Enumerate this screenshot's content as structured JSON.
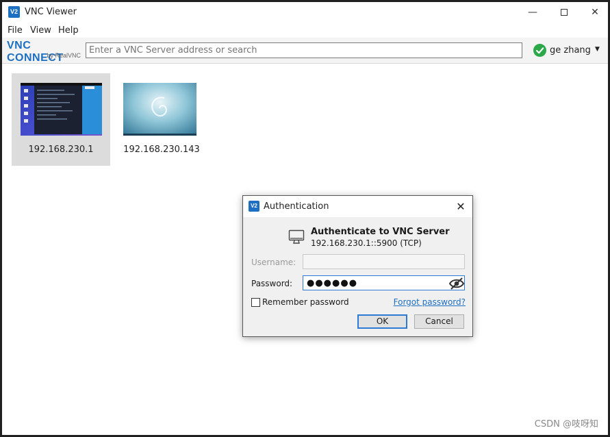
{
  "window": {
    "title": "VNC Viewer",
    "icon_text": "V2",
    "minimize_glyph": "—",
    "close_glyph": "✕"
  },
  "menu": {
    "items": [
      "File",
      "View",
      "Help"
    ]
  },
  "toolbar": {
    "logo_main": "VNC CONNECT",
    "logo_sub": "by RealVNC",
    "search_placeholder": "Enter a VNC Server address or search",
    "user_name": "ge zhang",
    "dropdown_glyph": "▼"
  },
  "connections": [
    {
      "label": "192.168.230.1",
      "selected": true
    },
    {
      "label": "192.168.230.143",
      "selected": false
    }
  ],
  "dialog": {
    "title": "Authentication",
    "icon_text": "V2",
    "close_glyph": "✕",
    "heading": "Authenticate to VNC Server",
    "server": "192.168.230.1::5900 (TCP)",
    "username_label": "Username:",
    "password_label": "Password:",
    "password_masked": "●●●●●●",
    "remember_label": "Remember password",
    "forgot_link": "Forgot password?",
    "ok_label": "OK",
    "cancel_label": "Cancel"
  },
  "watermark": "CSDN @吱呀知",
  "colors": {
    "accent": "#1d6fc2",
    "status_ok": "#2aa84a",
    "focus": "#2c7ad6"
  },
  "icons": [
    "vnc-app-icon",
    "minimize-icon",
    "maximize-icon",
    "close-icon",
    "status-check-icon",
    "chevron-down-icon",
    "monitor-icon",
    "eye-slash-icon"
  ]
}
